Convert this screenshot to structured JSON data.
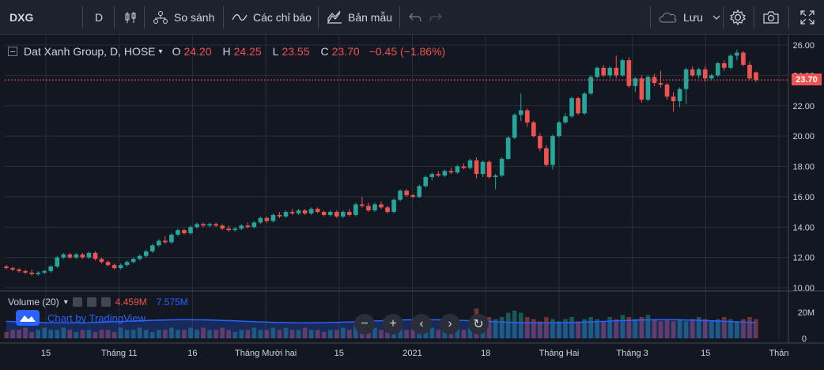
{
  "toolbar": {
    "symbol": "DXG",
    "interval": "D",
    "compare_label": "So sánh",
    "indicators_label": "Các chỉ báo",
    "templates_label": "Bản mẫu",
    "save_label": "Lưu"
  },
  "legend": {
    "title": "Dat Xanh Group, D, HOSE",
    "o_label": "O",
    "o": "24.20",
    "h_label": "H",
    "h": "24.25",
    "l_label": "L",
    "l": "23.55",
    "c_label": "C",
    "c": "23.70",
    "change": "−0.45 (−1.86%)"
  },
  "volume": {
    "label": "Volume (20)",
    "v1": "4.459M",
    "v2": "7.575M",
    "axis_top": "20M",
    "axis_zero": "0"
  },
  "watermark": "Chart by TradingView",
  "price_tag": "23.70",
  "colors": {
    "up": "#26a69a",
    "down": "#ef5350",
    "bg": "#131722",
    "grid": "#2a2e39",
    "ma": "#2962ff"
  },
  "chart_data": {
    "type": "candlestick",
    "price_axis": [
      "26.00",
      "24.00",
      "22.00",
      "20.00",
      "18.00",
      "16.00",
      "14.00",
      "12.00",
      "10.00"
    ],
    "ylim": [
      10,
      26
    ],
    "x_ticks": [
      "15",
      "Tháng 11",
      "16",
      "Tháng Mười hai",
      "15",
      "2021",
      "18",
      "Tháng Hai",
      "Tháng 3",
      "15",
      "Thán"
    ],
    "last_close": 23.7,
    "candles": [
      [
        11.4,
        11.5,
        11.2,
        11.3
      ],
      [
        11.3,
        11.4,
        11.1,
        11.2
      ],
      [
        11.2,
        11.3,
        11.0,
        11.1
      ],
      [
        11.1,
        11.2,
        10.9,
        11.0
      ],
      [
        11.0,
        11.2,
        10.8,
        10.9
      ],
      [
        10.9,
        11.1,
        10.8,
        11.0
      ],
      [
        11.0,
        11.2,
        10.9,
        11.1
      ],
      [
        11.1,
        11.5,
        11.0,
        11.4
      ],
      [
        11.4,
        12.1,
        11.3,
        12.0
      ],
      [
        12.0,
        12.3,
        11.9,
        12.2
      ],
      [
        12.2,
        12.3,
        11.9,
        12.0
      ],
      [
        12.0,
        12.3,
        11.9,
        12.2
      ],
      [
        12.2,
        12.3,
        11.9,
        12.0
      ],
      [
        12.0,
        12.4,
        11.9,
        12.3
      ],
      [
        12.3,
        12.4,
        11.8,
        11.9
      ],
      [
        11.9,
        12.0,
        11.6,
        11.7
      ],
      [
        11.7,
        11.8,
        11.4,
        11.5
      ],
      [
        11.5,
        11.6,
        11.2,
        11.3
      ],
      [
        11.3,
        11.6,
        11.2,
        11.5
      ],
      [
        11.5,
        11.8,
        11.4,
        11.7
      ],
      [
        11.7,
        12.0,
        11.6,
        11.9
      ],
      [
        11.9,
        12.2,
        11.8,
        12.1
      ],
      [
        12.1,
        12.5,
        12.0,
        12.4
      ],
      [
        12.4,
        12.9,
        12.3,
        12.8
      ],
      [
        12.8,
        13.2,
        12.7,
        13.1
      ],
      [
        13.1,
        13.4,
        12.9,
        13.0
      ],
      [
        13.0,
        13.6,
        12.9,
        13.5
      ],
      [
        13.5,
        13.9,
        13.4,
        13.8
      ],
      [
        13.8,
        13.9,
        13.5,
        13.6
      ],
      [
        13.6,
        14.1,
        13.5,
        14.0
      ],
      [
        14.0,
        14.3,
        13.9,
        14.2
      ],
      [
        14.2,
        14.3,
        14.0,
        14.1
      ],
      [
        14.1,
        14.3,
        14.0,
        14.2
      ],
      [
        14.2,
        14.3,
        14.0,
        14.1
      ],
      [
        14.1,
        14.2,
        13.8,
        13.9
      ],
      [
        13.9,
        14.1,
        13.7,
        13.8
      ],
      [
        13.8,
        14.0,
        13.7,
        13.9
      ],
      [
        13.9,
        14.2,
        13.8,
        14.1
      ],
      [
        14.1,
        14.3,
        13.9,
        14.0
      ],
      [
        14.0,
        14.4,
        13.9,
        14.3
      ],
      [
        14.3,
        14.7,
        14.2,
        14.6
      ],
      [
        14.6,
        14.7,
        14.3,
        14.4
      ],
      [
        14.4,
        14.9,
        14.3,
        14.8
      ],
      [
        14.8,
        15.0,
        14.6,
        14.7
      ],
      [
        14.7,
        15.1,
        14.6,
        15.0
      ],
      [
        15.0,
        15.2,
        14.8,
        14.9
      ],
      [
        14.9,
        15.2,
        14.8,
        15.1
      ],
      [
        15.1,
        15.2,
        14.8,
        14.9
      ],
      [
        14.9,
        15.3,
        14.8,
        15.2
      ],
      [
        15.2,
        15.3,
        14.9,
        15.0
      ],
      [
        15.0,
        15.1,
        14.7,
        14.8
      ],
      [
        14.8,
        15.1,
        14.7,
        15.0
      ],
      [
        15.0,
        15.1,
        14.6,
        14.7
      ],
      [
        14.7,
        15.1,
        14.6,
        15.0
      ],
      [
        15.0,
        15.2,
        14.7,
        14.8
      ],
      [
        14.8,
        15.6,
        14.7,
        15.5
      ],
      [
        15.5,
        16.0,
        15.3,
        15.4
      ],
      [
        15.4,
        15.6,
        15.0,
        15.1
      ],
      [
        15.1,
        15.6,
        15.0,
        15.5
      ],
      [
        15.5,
        15.7,
        15.2,
        15.3
      ],
      [
        15.3,
        15.4,
        14.9,
        15.0
      ],
      [
        15.0,
        15.9,
        14.9,
        15.8
      ],
      [
        15.8,
        16.5,
        15.7,
        16.4
      ],
      [
        16.4,
        16.5,
        16.0,
        16.1
      ],
      [
        16.1,
        16.2,
        15.9,
        16.0
      ],
      [
        16.0,
        16.8,
        15.9,
        16.7
      ],
      [
        16.7,
        17.4,
        16.6,
        17.3
      ],
      [
        17.3,
        17.6,
        17.1,
        17.5
      ],
      [
        17.5,
        17.7,
        17.3,
        17.4
      ],
      [
        17.4,
        17.8,
        17.3,
        17.7
      ],
      [
        17.7,
        17.9,
        17.5,
        17.6
      ],
      [
        17.6,
        18.1,
        17.5,
        18.0
      ],
      [
        18.0,
        18.2,
        17.8,
        17.9
      ],
      [
        17.9,
        18.5,
        17.8,
        18.4
      ],
      [
        18.4,
        18.6,
        17.2,
        17.5
      ],
      [
        17.5,
        18.4,
        17.3,
        18.3
      ],
      [
        18.3,
        18.4,
        17.2,
        17.3
      ],
      [
        17.3,
        17.5,
        16.5,
        17.4
      ],
      [
        17.4,
        18.6,
        17.3,
        18.5
      ],
      [
        18.5,
        20.0,
        18.4,
        19.9
      ],
      [
        19.9,
        21.5,
        19.8,
        21.4
      ],
      [
        21.4,
        22.8,
        21.0,
        21.7
      ],
      [
        21.7,
        21.8,
        20.6,
        20.9
      ],
      [
        20.9,
        21.0,
        19.9,
        20.0
      ],
      [
        20.0,
        20.2,
        19.0,
        19.2
      ],
      [
        19.2,
        19.4,
        18.0,
        18.1
      ],
      [
        18.1,
        20.1,
        17.8,
        20.0
      ],
      [
        20.0,
        21.0,
        19.9,
        20.9
      ],
      [
        20.9,
        21.5,
        20.8,
        21.3
      ],
      [
        21.3,
        22.6,
        21.2,
        22.5
      ],
      [
        22.5,
        22.6,
        21.4,
        21.5
      ],
      [
        21.5,
        22.9,
        21.4,
        22.8
      ],
      [
        22.8,
        24.0,
        22.7,
        23.9
      ],
      [
        23.9,
        24.6,
        23.8,
        24.5
      ],
      [
        24.5,
        24.7,
        23.9,
        24.0
      ],
      [
        24.0,
        24.6,
        23.8,
        24.5
      ],
      [
        24.5,
        25.3,
        23.8,
        24.0
      ],
      [
        24.0,
        25.1,
        23.9,
        25.0
      ],
      [
        25.0,
        25.2,
        23.2,
        23.3
      ],
      [
        23.3,
        23.9,
        22.9,
        23.8
      ],
      [
        23.8,
        24.0,
        22.2,
        22.4
      ],
      [
        22.4,
        24.0,
        22.3,
        23.9
      ],
      [
        23.9,
        24.1,
        23.3,
        23.5
      ],
      [
        23.5,
        24.3,
        23.2,
        23.4
      ],
      [
        23.4,
        23.5,
        22.4,
        22.6
      ],
      [
        22.6,
        22.9,
        21.6,
        22.3
      ],
      [
        22.3,
        23.2,
        21.9,
        23.1
      ],
      [
        23.1,
        24.5,
        22.1,
        24.4
      ],
      [
        24.4,
        24.6,
        23.9,
        24.0
      ],
      [
        24.0,
        24.5,
        23.8,
        24.4
      ],
      [
        24.4,
        24.6,
        23.6,
        23.8
      ],
      [
        23.8,
        24.1,
        23.7,
        24.0
      ],
      [
        24.0,
        24.9,
        23.9,
        24.8
      ],
      [
        24.8,
        25.0,
        24.3,
        24.5
      ],
      [
        24.5,
        25.4,
        24.4,
        25.3
      ],
      [
        25.3,
        25.7,
        25.0,
        25.5
      ],
      [
        25.5,
        25.6,
        24.6,
        24.7
      ],
      [
        24.7,
        24.9,
        23.7,
        23.8
      ],
      [
        24.2,
        24.25,
        23.55,
        23.7
      ]
    ],
    "volume_pattern": [
      3,
      4,
      4,
      5,
      3,
      4,
      5,
      4,
      4,
      5,
      4,
      3,
      4,
      4,
      3,
      4,
      4,
      3,
      5,
      4,
      4,
      5,
      4,
      3,
      4,
      4,
      5,
      4,
      4,
      5,
      4,
      5,
      4,
      4,
      5,
      4,
      3,
      4,
      4,
      5,
      4,
      4,
      5,
      4,
      5,
      4,
      4,
      5,
      4,
      4,
      3,
      4,
      4,
      5,
      4,
      6,
      5,
      4,
      5,
      4,
      3,
      5,
      6,
      4,
      4,
      5,
      6,
      5,
      4,
      5,
      4,
      5,
      4,
      5,
      14,
      8,
      10,
      9,
      10,
      12,
      13,
      12,
      10,
      9,
      8,
      10,
      9,
      8,
      9,
      10,
      8,
      9,
      10,
      9,
      8,
      10,
      9,
      11,
      10,
      9,
      10,
      11,
      9,
      8,
      9,
      8,
      9,
      8,
      9,
      10,
      9,
      8,
      9,
      10,
      9,
      8,
      9,
      10,
      9,
      8
    ]
  }
}
